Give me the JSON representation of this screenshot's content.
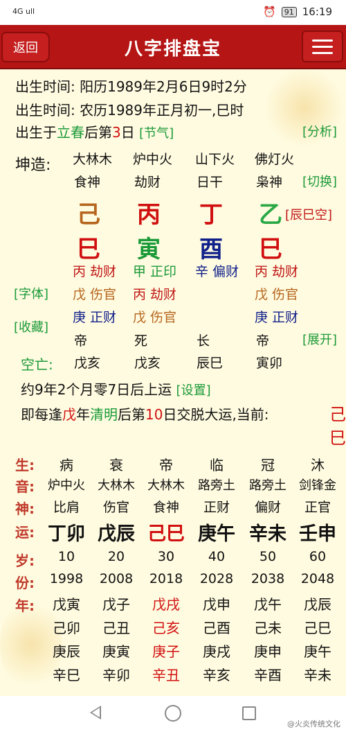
{
  "status_bar": {
    "signal": "4G ull",
    "battery": "91",
    "time": "16:19"
  },
  "header": {
    "back_label": "返回",
    "title": "八字排盘宝"
  },
  "birth": {
    "solar": "出生时间: 阳历1989年2月6日9时2分",
    "lunar": "出生时间: 农历1989年正月初一,巳时",
    "jieqi_prefix": "出生于",
    "jieqi_term": "立春",
    "jieqi_mid": "后第",
    "jieqi_day": "3",
    "jieqi_suffix": "日",
    "jieqi_link": "[节气]",
    "analyze_link": "[分析]"
  },
  "chart": {
    "label": "坤造:",
    "nayin": [
      "大林木",
      "炉中火",
      "山下火",
      "佛灯火"
    ],
    "shishen": [
      "食神",
      "劫财",
      "日干",
      "枭神"
    ],
    "switch_link": "[切换]",
    "stems": [
      "己",
      "丙",
      "丁",
      "乙"
    ],
    "stem_colors": [
      "#b5651d",
      "#d01010",
      "#d01010",
      "#2aa845"
    ],
    "kong_link": "[辰巳空]",
    "branches": [
      "巳",
      "寅",
      "酉",
      "巳"
    ],
    "branch_colors": [
      "#d01010",
      "#1a9a38",
      "#10208a",
      "#d01010"
    ],
    "hidden_row1": [
      {
        "stem": "丙",
        "god": "劫财",
        "color": "#c01818"
      },
      {
        "stem": "甲",
        "god": "正印",
        "color": "#1a9a38"
      },
      {
        "stem": "辛",
        "god": "偏财",
        "color": "#10208a"
      },
      {
        "stem": "丙",
        "god": "劫财",
        "color": "#c01818"
      }
    ],
    "hidden_row2": [
      {
        "stem": "戊",
        "god": "伤官",
        "color": "#b5651d"
      },
      {
        "stem": "丙",
        "god": "劫财",
        "color": "#c01818"
      },
      {
        "stem": "",
        "god": "",
        "color": "#111"
      },
      {
        "stem": "戊",
        "god": "伤官",
        "color": "#b5651d"
      }
    ],
    "hidden_row3": [
      {
        "stem": "庚",
        "god": "正财",
        "color": "#10208a"
      },
      {
        "stem": "戊",
        "god": "伤官",
        "color": "#b5651d"
      },
      {
        "stem": "",
        "god": "",
        "color": "#111"
      },
      {
        "stem": "庚",
        "god": "正财",
        "color": "#10208a"
      }
    ],
    "font_link": "[字体]",
    "collect_link": "[收藏]",
    "changsheng": [
      "帝",
      "死",
      "长",
      "帝"
    ],
    "expand_link": "[展开]",
    "kongwang_label": "空亡:",
    "kongwang": [
      "戊亥",
      "戊亥",
      "辰巳",
      "寅卯"
    ]
  },
  "luck": {
    "start": "约9年2个月零7日后上运",
    "settings_link": "[设置]",
    "rule_prefix": "即每逢",
    "rule_stem": "戊",
    "rule_mid1": "年",
    "rule_term": "清明",
    "rule_mid2": "后第",
    "rule_day": "10",
    "rule_suffix": "日交脱大运,当前:",
    "current": [
      "己",
      "巳"
    ]
  },
  "dayun": {
    "labels": [
      "生:",
      "音:",
      "神:",
      "运:",
      "岁:",
      "份:",
      "年:"
    ],
    "sheng": [
      "病",
      "衰",
      "帝",
      "临",
      "冠",
      "沐"
    ],
    "yin": [
      "炉中火",
      "大林木",
      "大林木",
      "路旁土",
      "路旁土",
      "剑锋金"
    ],
    "shen": [
      "比肩",
      "伤官",
      "食神",
      "正财",
      "偏财",
      "正官"
    ],
    "yun": [
      "丁卯",
      "戊辰",
      "己巳",
      "庚午",
      "辛未",
      "壬申"
    ],
    "yun_colors": [
      "#111",
      "#111",
      "#d01010",
      "#111",
      "#111",
      "#111"
    ],
    "age": [
      "10",
      "20",
      "30",
      "40",
      "50",
      "60"
    ],
    "year": [
      "1998",
      "2008",
      "2018",
      "2028",
      "2038",
      "2048"
    ],
    "liunian": [
      [
        "戊寅",
        "戊子",
        "戊戌",
        "戊申",
        "戊午",
        "戊辰"
      ],
      [
        "己卯",
        "己丑",
        "己亥",
        "己酉",
        "己未",
        "己巳"
      ],
      [
        "庚辰",
        "庚寅",
        "庚子",
        "庚戌",
        "庚申",
        "庚午"
      ],
      [
        "辛巳",
        "辛卯",
        "辛丑",
        "辛亥",
        "辛酉",
        "辛未"
      ]
    ],
    "liunian_highlight_col": 2
  },
  "watermark": "@火炎传统文化"
}
